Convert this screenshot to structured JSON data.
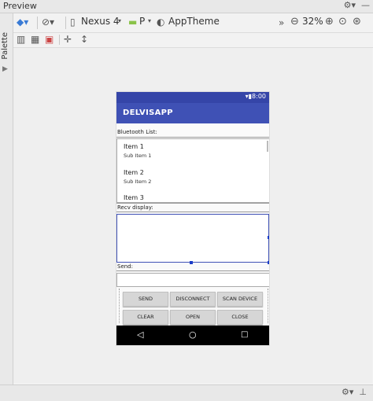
{
  "window": {
    "title": "Preview",
    "right_icons": "⚙ - ⇤"
  },
  "palette": {
    "label": "Palette"
  },
  "toolbar": {
    "device": "Nexus 4",
    "api": "P",
    "theme": "AppTheme",
    "zoom": "32%"
  },
  "phone": {
    "time": "8:00",
    "app_title": "DELVISAPP",
    "bluetooth_label": "Bluetooth List:",
    "items": [
      {
        "title": "Item 1",
        "sub": "Sub Item 1"
      },
      {
        "title": "Item 2",
        "sub": "Sub Item 2"
      },
      {
        "title": "Item 3",
        "sub": ""
      }
    ],
    "recv_label": "Recv display:",
    "send_label": "Send:",
    "buttons_row1": [
      "SEND",
      "DISCONNECT",
      "SCAN DEVICE"
    ],
    "buttons_row2": [
      "CLEAR",
      "OPEN",
      "CLOSE"
    ]
  },
  "colors": {
    "primary": "#3f51b5",
    "primary_dark": "#3545a8",
    "button": "#d6d6d6"
  }
}
